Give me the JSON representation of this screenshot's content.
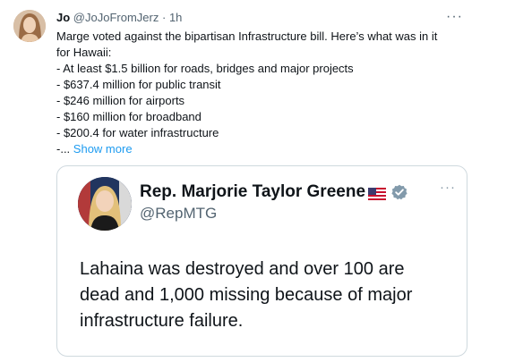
{
  "tweet": {
    "author_name": "Jo",
    "author_handle": "@JoJoFromJerz",
    "separator": "·",
    "time": "1h",
    "more_label": "···",
    "lines": [
      "Marge voted against the bipartisan Infrastructure bill. Here’s what was in it",
      "for Hawaii:",
      "- At least $1.5 billion for roads, bridges and major projects",
      "- $637.4 million for public transit",
      "- $246 million for airports",
      "- $160 million for broadband",
      "- $200.4 for water infrastructure"
    ],
    "truncated_prefix": "-...",
    "show_more_label": "Show more"
  },
  "quoted_tweet": {
    "author_name": "Rep. Marjorie Taylor Greene",
    "author_handle": "@RepMTG",
    "more_label": "···",
    "lines": [
      "Lahaina was destroyed and over 100 are",
      "dead and 1,000 missing because of major",
      "infrastructure failure."
    ]
  },
  "colors": {
    "link": "#1d9bf0",
    "secondary_text": "#536471",
    "border": "#cfd9de",
    "verified_badge": "#829aab"
  },
  "icons": [
    "avatar",
    "us-flag-icon",
    "verified-badge-icon",
    "more-options-icon"
  ]
}
